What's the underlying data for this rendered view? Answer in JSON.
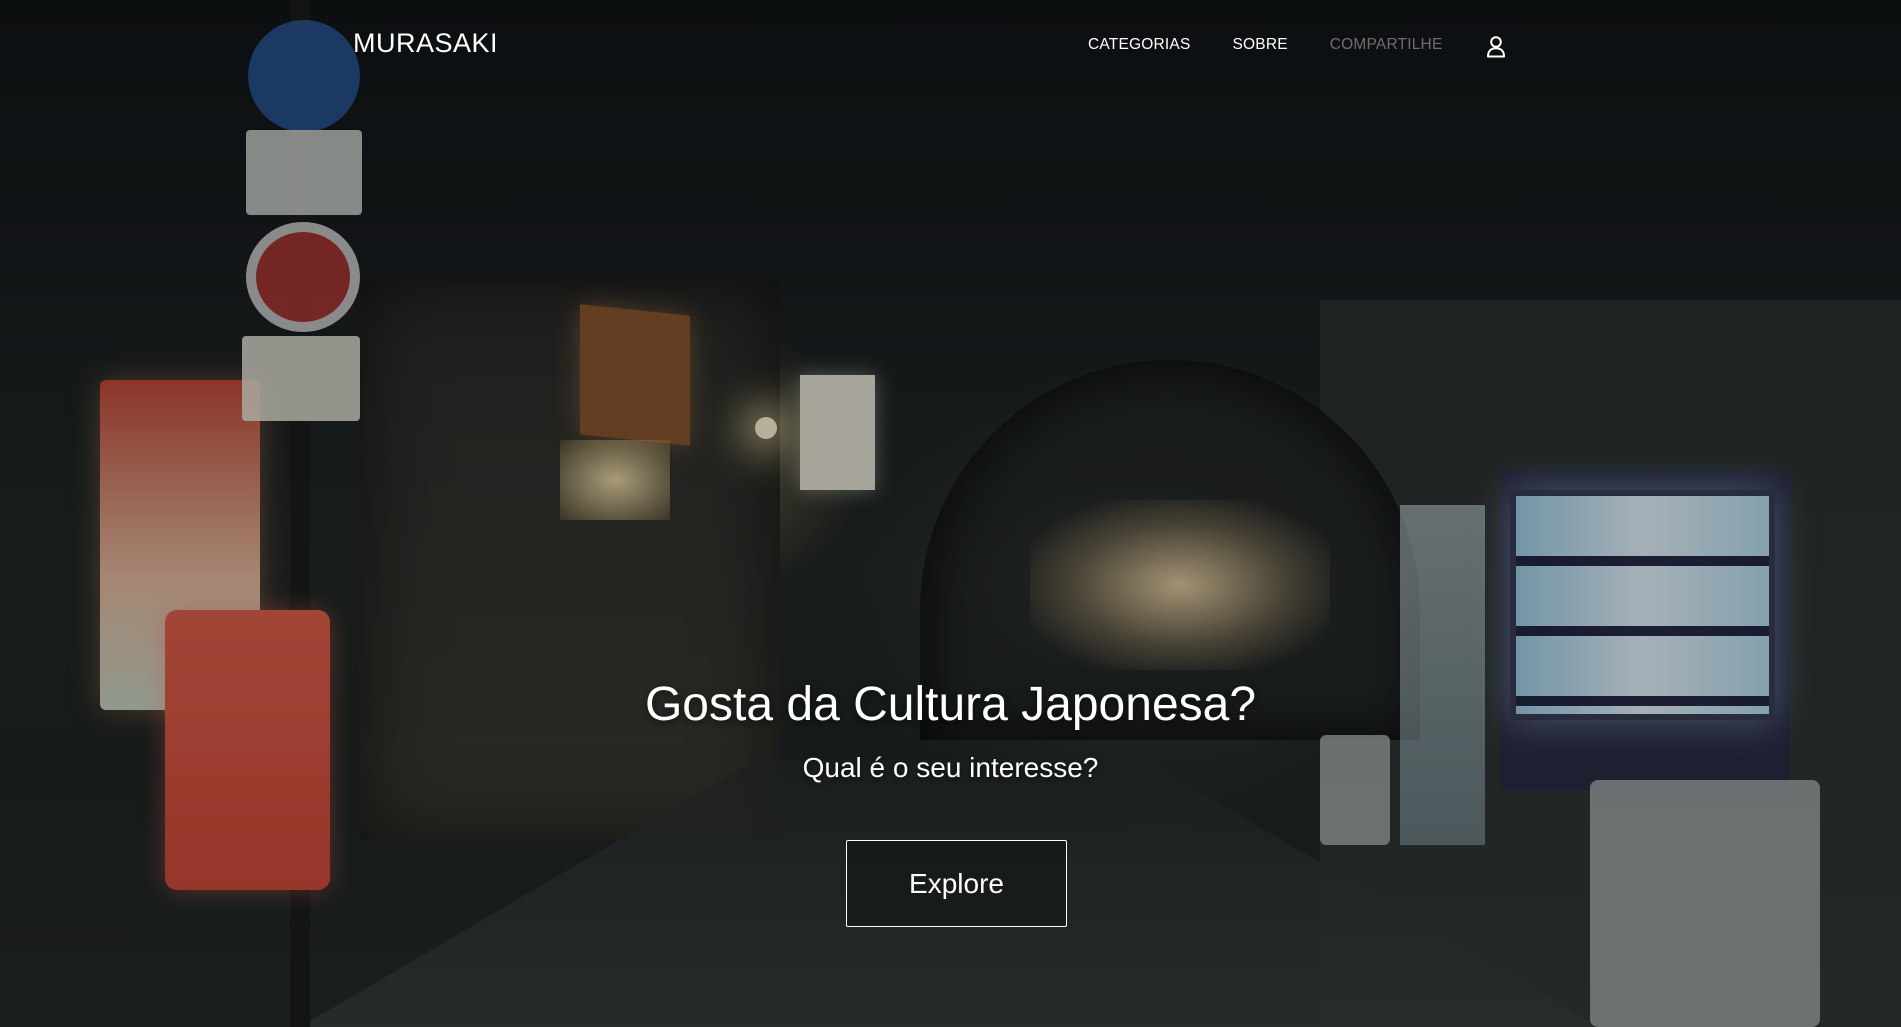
{
  "brand": {
    "name": "MURASAKI"
  },
  "nav": {
    "items": [
      {
        "label": "CATEGORIAS",
        "state": "normal"
      },
      {
        "label": "SOBRE",
        "state": "normal"
      },
      {
        "label": "COMPARTILHE",
        "state": "dim"
      }
    ],
    "user_icon": "user-icon"
  },
  "hero": {
    "title": "Gosta da Cultura Japonesa?",
    "subtitle": "Qual é o seu interesse?",
    "cta_label": "Explore",
    "background": "night street in Japan with illuminated signs and vending machine"
  },
  "colors": {
    "text": "#ffffff",
    "nav_dim": "#6e6e6e",
    "button_border": "#ffffff"
  }
}
